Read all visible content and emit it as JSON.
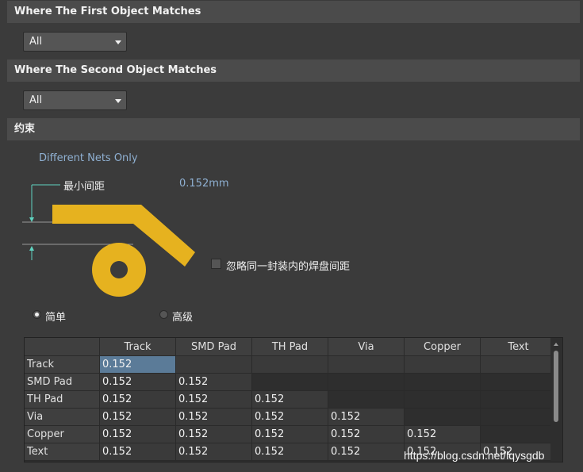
{
  "first_object": {
    "header": "Where The First Object Matches",
    "selected": "All"
  },
  "second_object": {
    "header": "Where The Second Object Matches",
    "selected": "All"
  },
  "constraints": {
    "header": "约束",
    "net_scope": "Different Nets Only",
    "min_clearance_label": "最小间距",
    "min_clearance_value": "0.152mm",
    "ignore_pads_label": "忽略同一封装内的焊盘间距",
    "ignore_pads_checked": false,
    "mode_simple": "简单",
    "mode_advanced": "高级",
    "mode_selected": "simple"
  },
  "grid": {
    "columns": [
      "Track",
      "SMD Pad",
      "TH Pad",
      "Via",
      "Copper",
      "Text"
    ],
    "rows": [
      {
        "label": "Track",
        "cells": [
          "0.152",
          "",
          "",
          "",
          "",
          ""
        ]
      },
      {
        "label": "SMD Pad",
        "cells": [
          "0.152",
          "0.152",
          "",
          "",
          "",
          ""
        ]
      },
      {
        "label": "TH Pad",
        "cells": [
          "0.152",
          "0.152",
          "0.152",
          "",
          "",
          ""
        ]
      },
      {
        "label": "Via",
        "cells": [
          "0.152",
          "0.152",
          "0.152",
          "0.152",
          "",
          ""
        ]
      },
      {
        "label": "Copper",
        "cells": [
          "0.152",
          "0.152",
          "0.152",
          "0.152",
          "0.152",
          ""
        ]
      },
      {
        "label": "Text",
        "cells": [
          "0.152",
          "0.152",
          "0.152",
          "0.152",
          "0.152",
          "0.152"
        ]
      }
    ]
  },
  "watermark": "https://blog.csdn.net/lqysgdb",
  "colors": {
    "background": "#3b3b3b",
    "header": "#4b4b4b",
    "diagram_yellow": "#e6b21f",
    "selection": "#5b7b98",
    "label_blue": "#8fb0d2"
  }
}
